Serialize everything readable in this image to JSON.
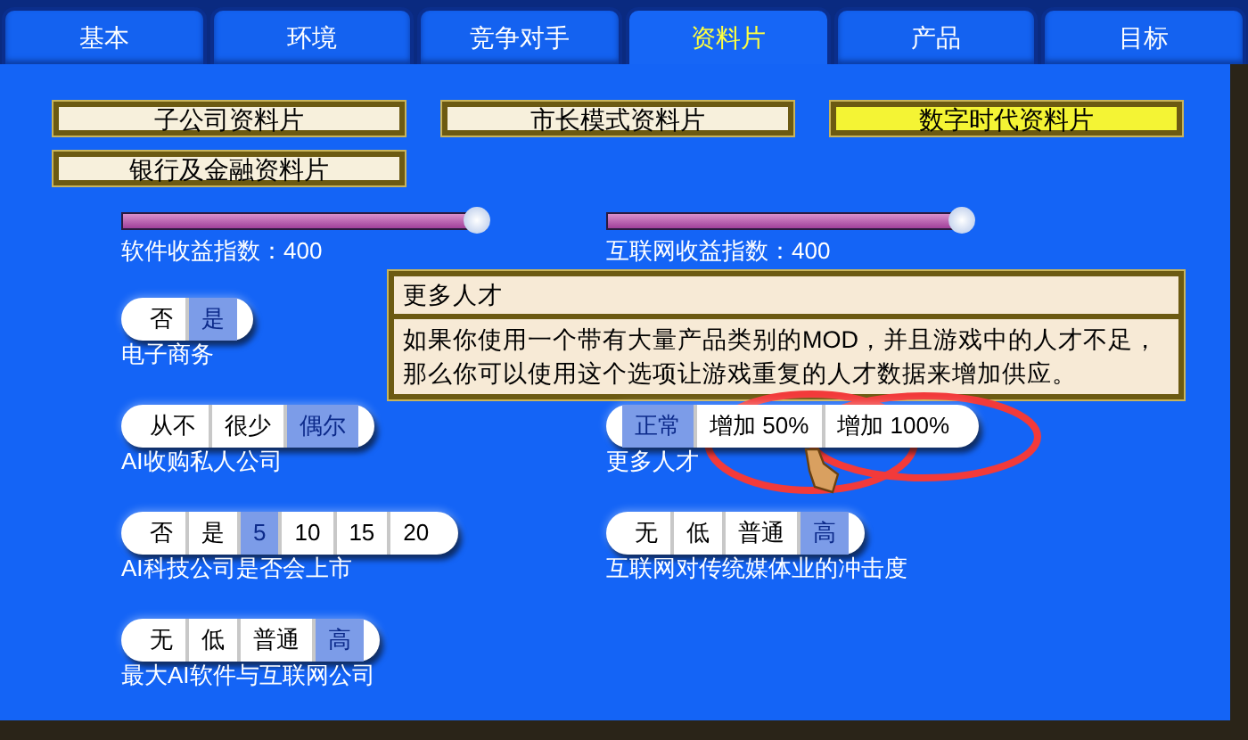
{
  "tabs": [
    {
      "label": "基本",
      "selected": false
    },
    {
      "label": "环境",
      "selected": false
    },
    {
      "label": "竞争对手",
      "selected": false
    },
    {
      "label": "资料片",
      "selected": true
    },
    {
      "label": "产品",
      "selected": false
    },
    {
      "label": "目标",
      "selected": false
    }
  ],
  "expansion_buttons": [
    {
      "label": "子公司资料片",
      "selected": false
    },
    {
      "label": "市长模式资料片",
      "selected": false
    },
    {
      "label": "数字时代资料片",
      "selected": true
    },
    {
      "label": "银行及金融资料片",
      "selected": false
    }
  ],
  "left_column": {
    "slider": {
      "label": "软件收益指数：400",
      "level": 0.98
    },
    "options": [
      {
        "label": "电子商务",
        "choices": [
          {
            "label": "否",
            "selected": false
          },
          {
            "label": "是",
            "selected": true
          }
        ]
      },
      {
        "label": "AI收购私人公司",
        "choices": [
          {
            "label": "从不",
            "selected": false
          },
          {
            "label": "很少",
            "selected": false
          },
          {
            "label": "偶尔",
            "selected": true
          }
        ]
      },
      {
        "label": "AI科技公司是否会上市",
        "choices": [
          {
            "label": "否",
            "selected": false
          },
          {
            "label": "是",
            "selected": false
          },
          {
            "label": "5",
            "selected": true
          },
          {
            "label": "10",
            "selected": false
          },
          {
            "label": "15",
            "selected": false
          },
          {
            "label": "20",
            "selected": false
          }
        ]
      },
      {
        "label": "最大AI软件与互联网公司",
        "choices": [
          {
            "label": "无",
            "selected": false
          },
          {
            "label": "低",
            "selected": false
          },
          {
            "label": "普通",
            "selected": false
          },
          {
            "label": "高",
            "selected": true
          }
        ]
      }
    ]
  },
  "right_column": {
    "slider": {
      "label": "互联网收益指数：400",
      "level": 0.98
    },
    "options": [
      {
        "label": "更多人才",
        "choices": [
          {
            "label": "正常",
            "selected": true
          },
          {
            "label": "增加 50%",
            "selected": false
          },
          {
            "label": "增加 100%",
            "selected": false
          }
        ]
      },
      {
        "label": "互联网对传统媒体业的冲击度",
        "choices": [
          {
            "label": "无",
            "selected": false
          },
          {
            "label": "低",
            "selected": false
          },
          {
            "label": "普通",
            "selected": false
          },
          {
            "label": "高",
            "selected": true
          }
        ]
      }
    ]
  },
  "tooltip": {
    "title": "更多人才",
    "text": "如果你使用一个带有大量产品类别的MOD，并且游戏中的人才不足，那么你可以使用这个选项让游戏重复的人才数据来增加供应。"
  }
}
